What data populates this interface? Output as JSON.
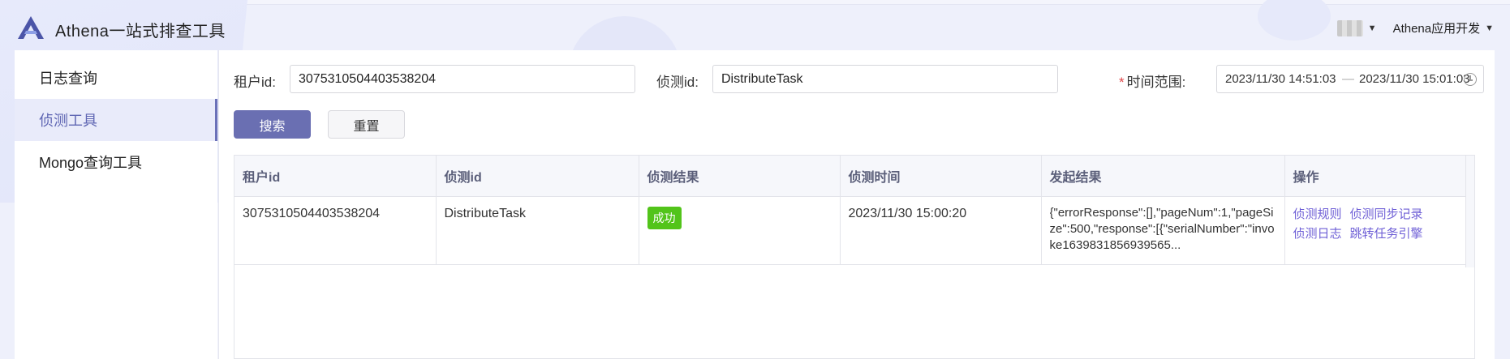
{
  "app": {
    "title": "Athena一站式排查工具"
  },
  "user": {
    "org": "Athena应用开发"
  },
  "sidebar": {
    "items": [
      {
        "label": "日志查询"
      },
      {
        "label": "侦测工具"
      },
      {
        "label": "Mongo查询工具"
      }
    ],
    "active_index": 1
  },
  "form": {
    "tenant_label": "租户id:",
    "tenant_value": "3075310504403538204",
    "detect_label": "侦测id:",
    "detect_value": "DistributeTask",
    "time_required": "*",
    "time_label": "时间范围:",
    "time_start": "2023/11/30 14:51:03",
    "time_sep": "—",
    "time_end": "2023/11/30 15:01:03"
  },
  "buttons": {
    "search": "搜索",
    "reset": "重置"
  },
  "table": {
    "headers": [
      "租户id",
      "侦测id",
      "侦测结果",
      "侦测时间",
      "发起结果",
      "操作"
    ],
    "rows": [
      {
        "tenant": "3075310504403538204",
        "detect_id": "DistributeTask",
        "status": "成功",
        "time": "2023/11/30 15:00:20",
        "result": "{\"errorResponse\":[],\"pageNum\":1,\"pageSize\":500,\"response\":[{\"serialNumber\":\"invoke1639831856939565...",
        "ops": [
          "侦测规则",
          "侦测同步记录",
          "侦测日志",
          "跳转任务引擎"
        ]
      }
    ]
  },
  "colors": {
    "accent": "#6a6fb2",
    "success": "#52c41a",
    "link": "#6e5fd6"
  }
}
